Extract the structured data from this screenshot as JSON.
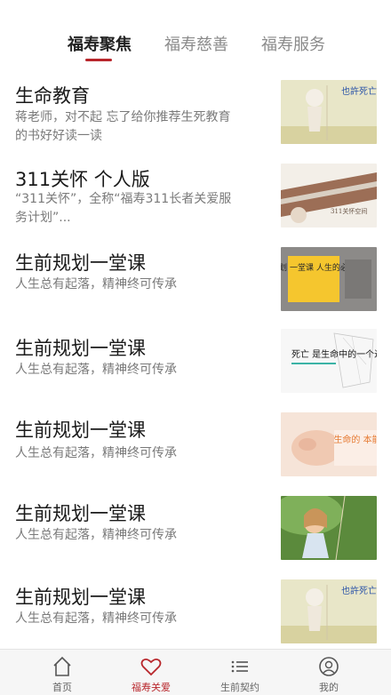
{
  "tabs": [
    {
      "label": "福寿聚焦",
      "active": true
    },
    {
      "label": "福寿慈善",
      "active": false
    },
    {
      "label": "福寿服务",
      "active": false
    }
  ],
  "items": [
    {
      "title": "生命教育",
      "desc": "蒋老师，对不起 忘了给你推荐生死教育的书好好读一读",
      "thumb": "也許死亡 就像 變成一隻蝴蝶"
    },
    {
      "title": "311关怀 个人版",
      "desc": "“311关怀”，全称“福寿311长者关爱服务计划”...",
      "thumb": "311关怀空间"
    },
    {
      "title": "生前规划一堂课",
      "desc": "人生总有起落，精神终可传承",
      "thumb": "生前规划 一堂课 人生的必修科目"
    },
    {
      "title": "生前规划一堂课",
      "desc": "人生总有起落，精神终可传承",
      "thumb": "死亡 是生命中的一个过程"
    },
    {
      "title": "生前规划一堂课",
      "desc": "人生总有起落，精神终可传承",
      "thumb": "生命的 本能"
    },
    {
      "title": "生前规划一堂课",
      "desc": "人生总有起落，精神终可传承",
      "thumb": ""
    },
    {
      "title": "生前规划一堂课",
      "desc": "人生总有起落，精神终可传承",
      "thumb": "也許死亡 就像 變成一隻蝴蝶"
    }
  ],
  "bottom_nav": [
    {
      "label": "首页",
      "icon": "home-icon",
      "active": false
    },
    {
      "label": "福寿关爱",
      "icon": "heart-icon",
      "active": true
    },
    {
      "label": "生前契约",
      "icon": "list-icon",
      "active": false
    },
    {
      "label": "我的",
      "icon": "user-icon",
      "active": false
    }
  ],
  "colors": {
    "accent": "#b8262b",
    "text": "#1a1a1a",
    "subtext": "#7a7a7a"
  }
}
